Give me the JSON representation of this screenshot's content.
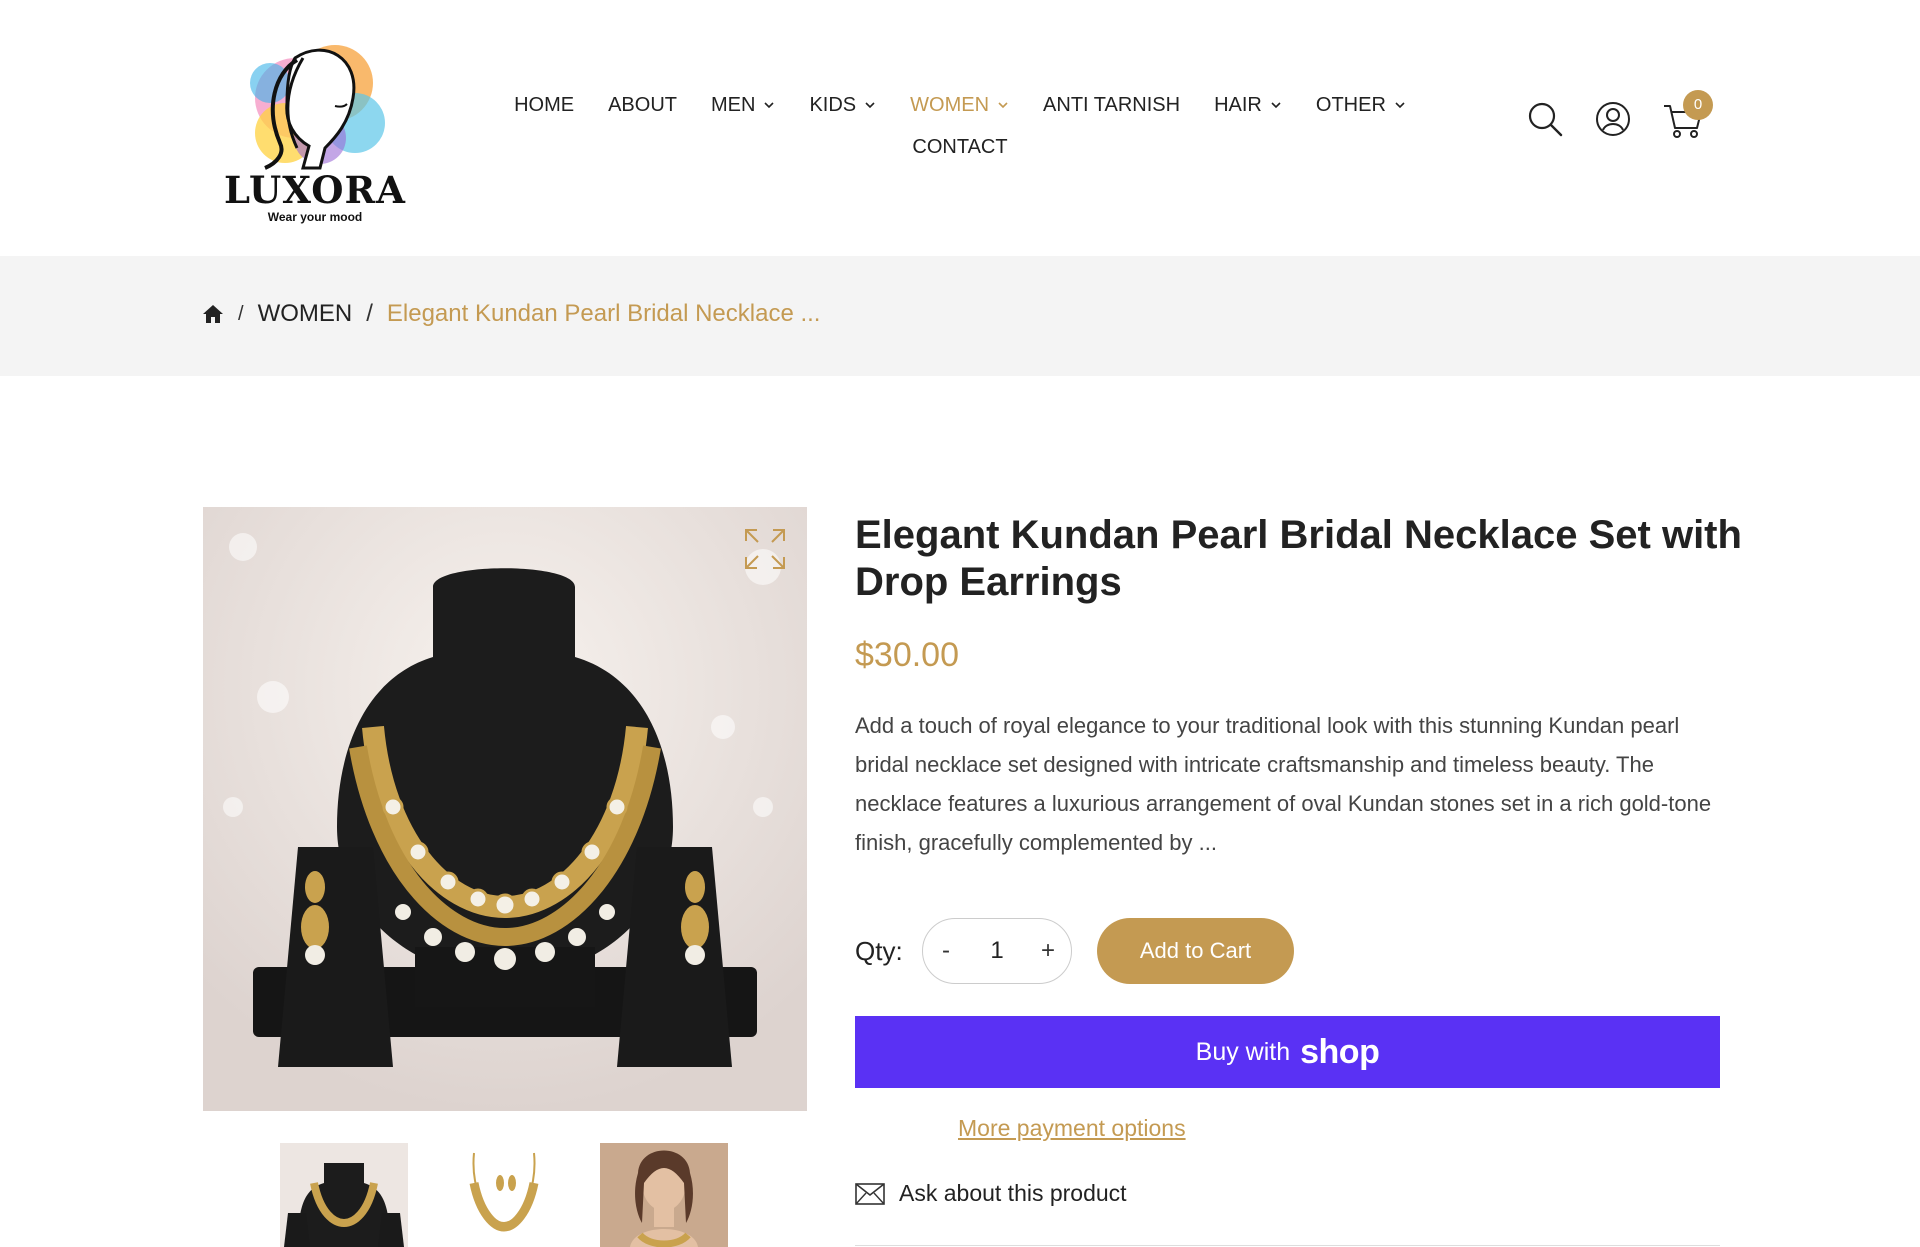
{
  "brand": {
    "name": "LUXORA",
    "tagline": "Wear your mood",
    "accent_color": "#c49a52"
  },
  "nav": {
    "row1": [
      {
        "label": "HOME",
        "dropdown": false,
        "active": false
      },
      {
        "label": "ABOUT",
        "dropdown": false,
        "active": false
      },
      {
        "label": "MEN",
        "dropdown": true,
        "active": false
      },
      {
        "label": "KIDS",
        "dropdown": true,
        "active": false
      },
      {
        "label": "WOMEN",
        "dropdown": true,
        "active": true
      },
      {
        "label": "ANTI TARNISH",
        "dropdown": false,
        "active": false
      },
      {
        "label": "HAIR",
        "dropdown": true,
        "active": false
      },
      {
        "label": "OTHER",
        "dropdown": true,
        "active": false
      }
    ],
    "row2": [
      {
        "label": "CONTACT",
        "dropdown": false,
        "active": false
      }
    ]
  },
  "header_icons": {
    "search": "search-icon",
    "account": "user-icon",
    "cart": "cart-icon",
    "cart_count": "0"
  },
  "breadcrumb": {
    "home_icon": "home-icon",
    "separator": "/",
    "category": "WOMEN",
    "current": "Elegant Kundan Pearl Bridal Necklace ..."
  },
  "product": {
    "title": "Elegant Kundan Pearl Bridal Necklace Set with Drop Earrings",
    "price": "$30.00",
    "description": "Add a touch of royal elegance to your traditional look with this stunning Kundan pearl bridal necklace set designed with intricate craftsmanship and timeless beauty. The necklace features a luxurious arrangement of oval Kundan stones set in a rich gold-tone finish, gracefully complemented by ...",
    "qty_label": "Qty:",
    "qty_value": "1",
    "qty_minus": "-",
    "qty_plus": "+",
    "add_to_cart": "Add to Cart",
    "buy_with": "Buy with",
    "shop_word": "shop",
    "shop_color": "#5a31f4",
    "more_payment": "More payment options",
    "ask": "Ask about this product"
  }
}
